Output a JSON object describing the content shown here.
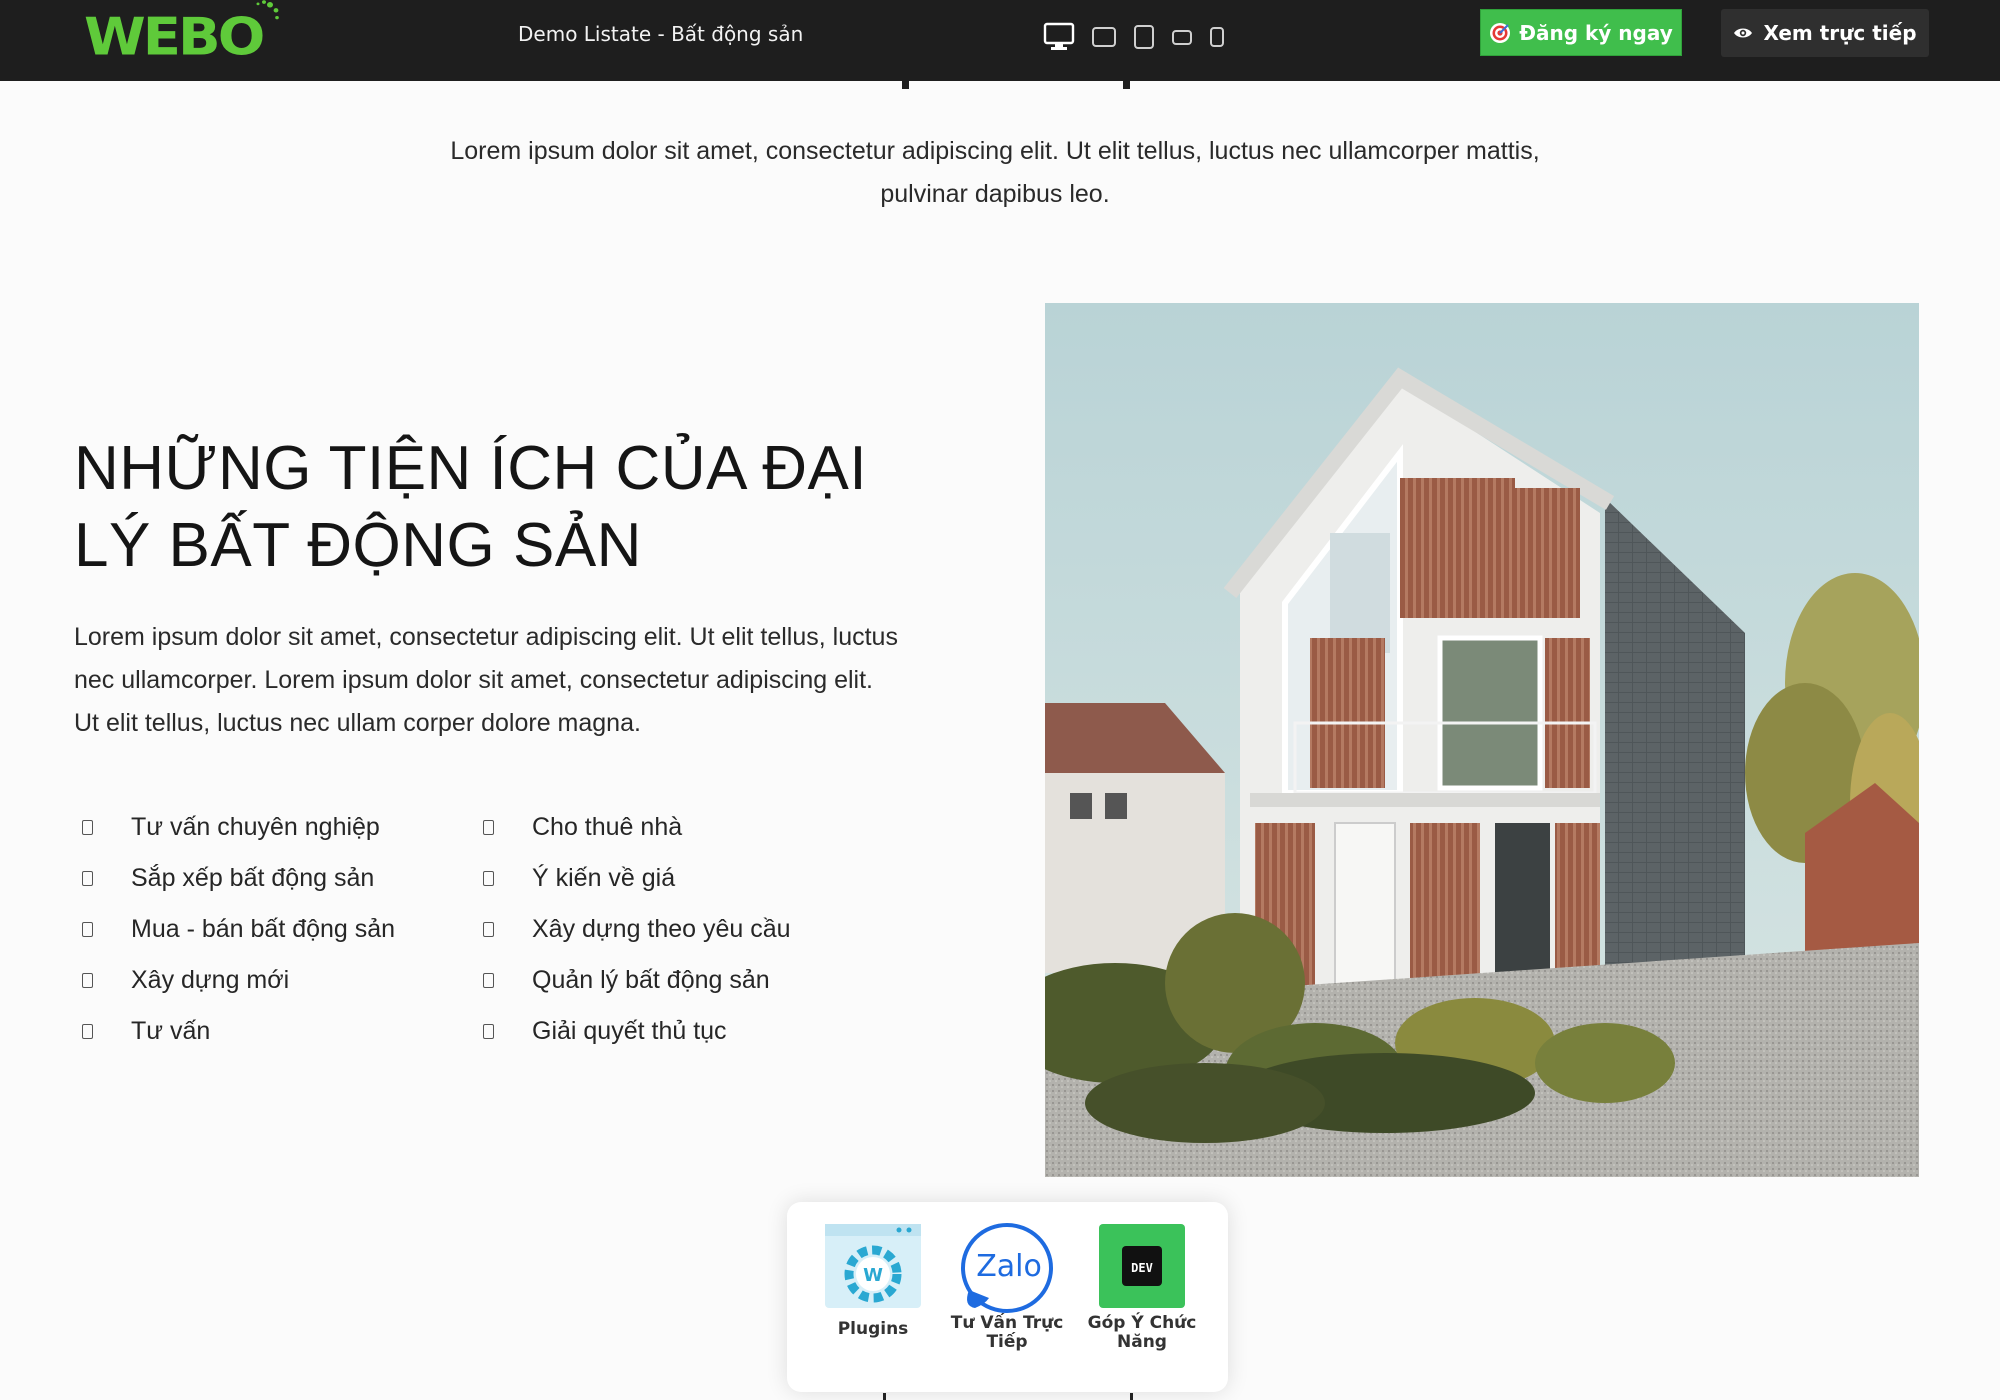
{
  "header": {
    "logo_text": "WEBO",
    "demo_title": "Demo Listate - Bất động sản",
    "devices": [
      "desktop-icon",
      "laptop-icon",
      "tablet-icon",
      "tablet-landscape-icon",
      "mobile-icon"
    ],
    "register_label": "Đăng ký ngay",
    "live_label": "Xem trực tiếp"
  },
  "intro": {
    "text": "Lorem ipsum dolor sit amet, consectetur adipiscing elit. Ut elit tellus, luctus nec ullamcorper mattis, pulvinar dapibus leo."
  },
  "feature": {
    "title_line1": "NHỮNG TIỆN ÍCH CỦA ĐẠI",
    "title_line2": "LÝ BẤT ĐỘNG SẢN",
    "description": "Lorem ipsum dolor sit amet, consectetur adipiscing elit. Ut elit tellus, luctus nec ullamcorper. Lorem ipsum dolor sit amet, consectetur adipiscing elit. Ut elit tellus, luctus nec ullam corper dolore magna.",
    "list_left": [
      "Tư vấn chuyên nghiệp",
      "Sắp xếp bất động sản",
      "Mua - bán bất động sản",
      "Xây dựng mới",
      "Tư vấn"
    ],
    "list_right": [
      "Cho thuê nhà",
      "Ý kiến về giá",
      "Xây dựng theo yêu cầu",
      "Quản lý bất động sản",
      "Giải quyết thủ tục"
    ]
  },
  "widget": {
    "plugins_label": "Plugins",
    "plugins_icon_letter": "W",
    "zalo_label_line1": "Tư Vấn Trực",
    "zalo_label_line2": "Tiếp",
    "zalo_logo_text": "Zalo",
    "dev_label_line1": "Góp Ý Chức",
    "dev_label_line2": "Năng",
    "dev_logo_text": "DEV"
  },
  "colors": {
    "topbar": "#1e1e1e",
    "brand_green": "#5fca3a",
    "register_button": "#40be4c",
    "live_button": "#2f2f2f"
  }
}
